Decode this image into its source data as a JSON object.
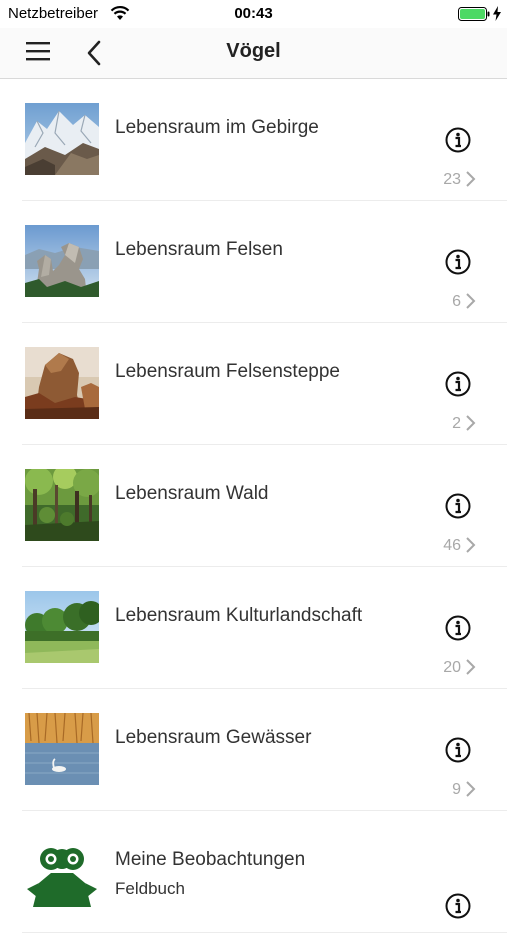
{
  "status_bar": {
    "carrier": "Netzbetreiber",
    "time": "00:43"
  },
  "nav": {
    "title": "Vögel"
  },
  "colors": {
    "accent_green": "#1f6b2a",
    "count_gray": "#a8a8a8",
    "battery_green": "#4cd964"
  },
  "rows": [
    {
      "title": "Lebensraum im Gebirge",
      "count": "23",
      "image": "mountain-glacier-photo"
    },
    {
      "title": "Lebensraum Felsen",
      "count": "6",
      "image": "rock-tower-photo"
    },
    {
      "title": "Lebensraum Felsensteppe",
      "count": "2",
      "image": "rock-steppe-photo"
    },
    {
      "title": "Lebensraum Wald",
      "count": "46",
      "image": "forest-photo"
    },
    {
      "title": "Lebensraum Kulturlandschaft",
      "count": "20",
      "image": "meadow-trees-photo"
    },
    {
      "title": "Lebensraum Gewässer",
      "count": "9",
      "image": "lake-swan-photo"
    }
  ],
  "observations": {
    "title": "Meine Beobachtungen",
    "subtitle": "Feldbuch",
    "icon": "binoculars-icon"
  }
}
